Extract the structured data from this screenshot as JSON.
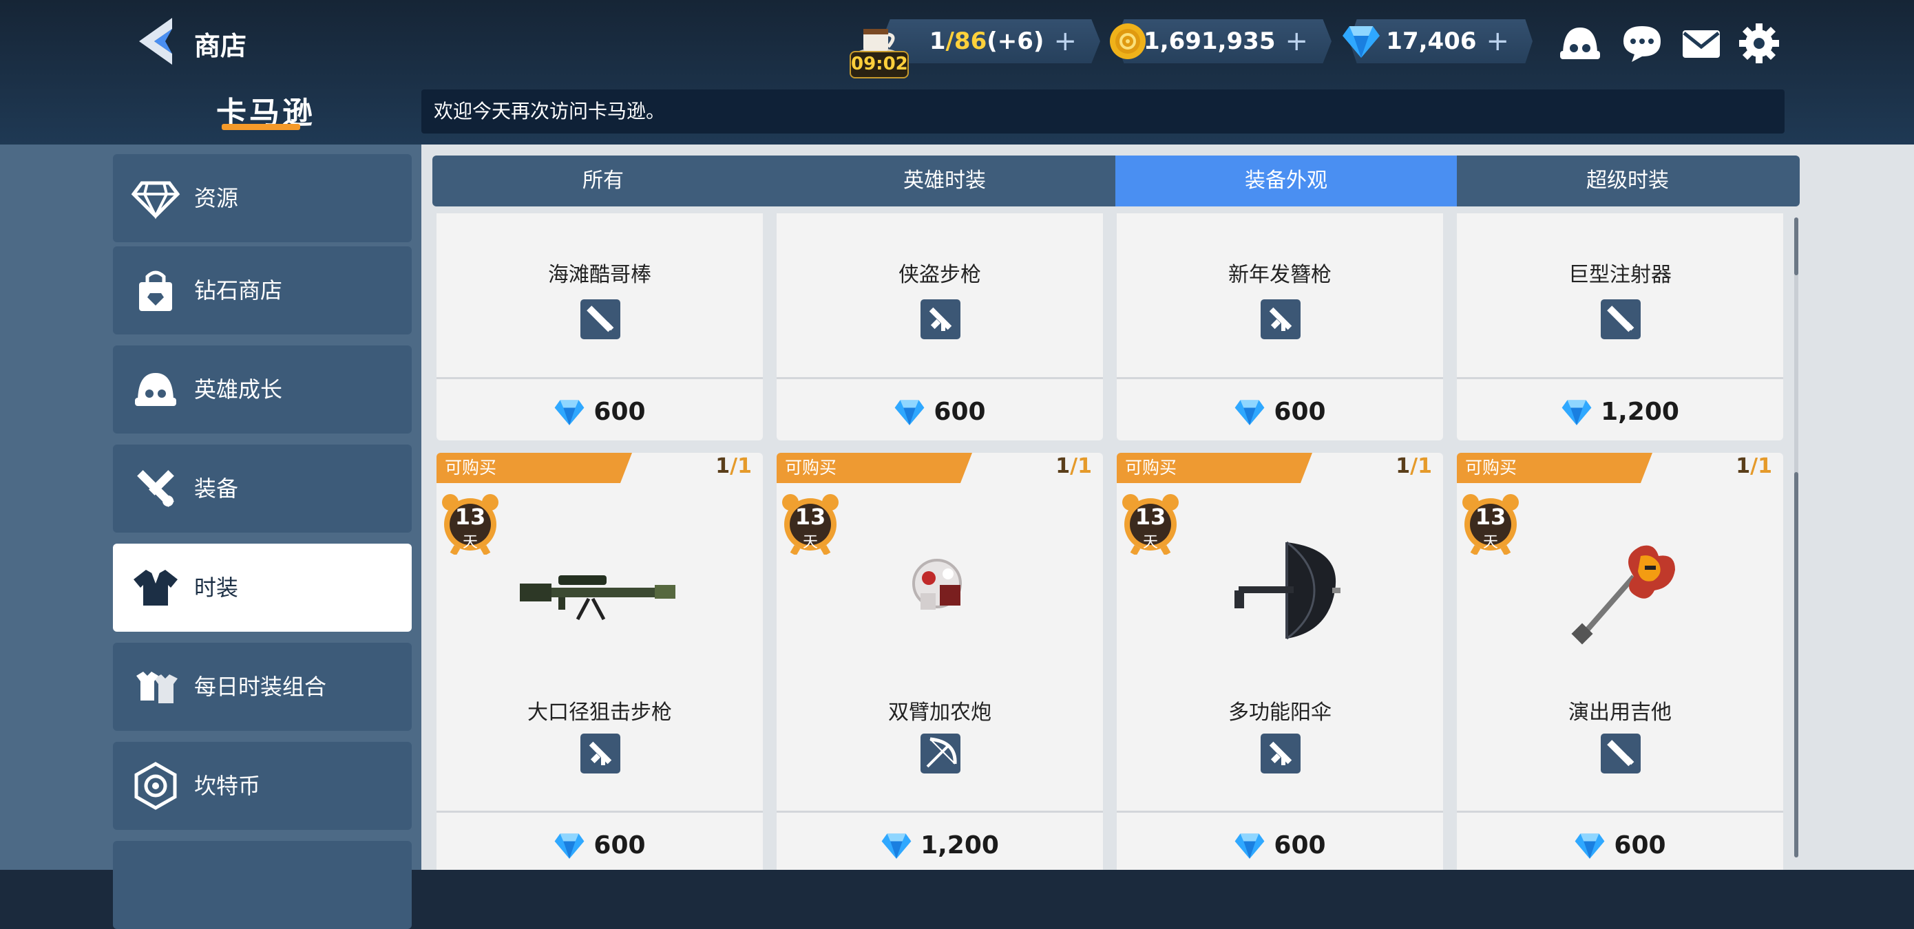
{
  "header": {
    "title": "商店",
    "brand": "卡马逊",
    "welcome": "欢迎今天再次访问卡马逊。"
  },
  "resources": {
    "stamina_current": "1",
    "stamina_max": "/86",
    "stamina_bonus": "(+6)",
    "stamina_timer": "09:02",
    "gold": "1,691,935",
    "gems": "17,406",
    "plus_label": "+"
  },
  "sidebar": {
    "items": [
      {
        "label": "资源",
        "icon": "diamond-icon"
      },
      {
        "label": "钻石商店",
        "icon": "shopping-bag-icon"
      },
      {
        "label": "英雄成长",
        "icon": "hero-icon"
      },
      {
        "label": "装备",
        "icon": "weapons-icon"
      },
      {
        "label": "时装",
        "icon": "costume-icon",
        "active": true
      },
      {
        "label": "每日时装组合",
        "icon": "costume-set-icon"
      },
      {
        "label": "坎特币",
        "icon": "kant-coin-icon"
      }
    ]
  },
  "tabs": [
    {
      "label": "所有"
    },
    {
      "label": "英雄时装"
    },
    {
      "label": "装备外观",
      "active": true
    },
    {
      "label": "超级时装"
    }
  ],
  "cards_row1": [
    {
      "name": "海滩酷哥棒",
      "type_icon": "melee-weapon-icon",
      "price": "600"
    },
    {
      "name": "侠盗步枪",
      "type_icon": "gun-icon",
      "price": "600"
    },
    {
      "name": "新年发簪枪",
      "type_icon": "gun-icon",
      "price": "600"
    },
    {
      "name": "巨型注射器",
      "type_icon": "melee-weapon-icon",
      "price": "1,200"
    }
  ],
  "cards_row2": [
    {
      "badge": "可购买",
      "limit_used": "1",
      "limit_total": "/1",
      "days": "13",
      "day_unit": "天",
      "name": "大口径狙击步枪",
      "type_icon": "gun-icon",
      "price": "600",
      "image": "sniper-rifle-icon"
    },
    {
      "badge": "可购买",
      "limit_used": "1",
      "limit_total": "/1",
      "days": "13",
      "day_unit": "天",
      "name": "双臂加农炮",
      "type_icon": "bow-icon",
      "price": "1,200",
      "image": "arm-cannon-icon"
    },
    {
      "badge": "可购买",
      "limit_used": "1",
      "limit_total": "/1",
      "days": "13",
      "day_unit": "天",
      "name": "多功能阳伞",
      "type_icon": "gun-icon",
      "price": "600",
      "image": "parasol-gun-icon"
    },
    {
      "badge": "可购买",
      "limit_used": "1",
      "limit_total": "/1",
      "days": "13",
      "day_unit": "天",
      "name": "演出用吉他",
      "type_icon": "melee-weapon-icon",
      "price": "600",
      "image": "electric-guitar-icon"
    }
  ],
  "colors": {
    "accent_orange": "#f59a2a",
    "active_tab": "#4a8ff2",
    "gem_blue": "#2fa8ff",
    "gold": "#f0b21a"
  }
}
